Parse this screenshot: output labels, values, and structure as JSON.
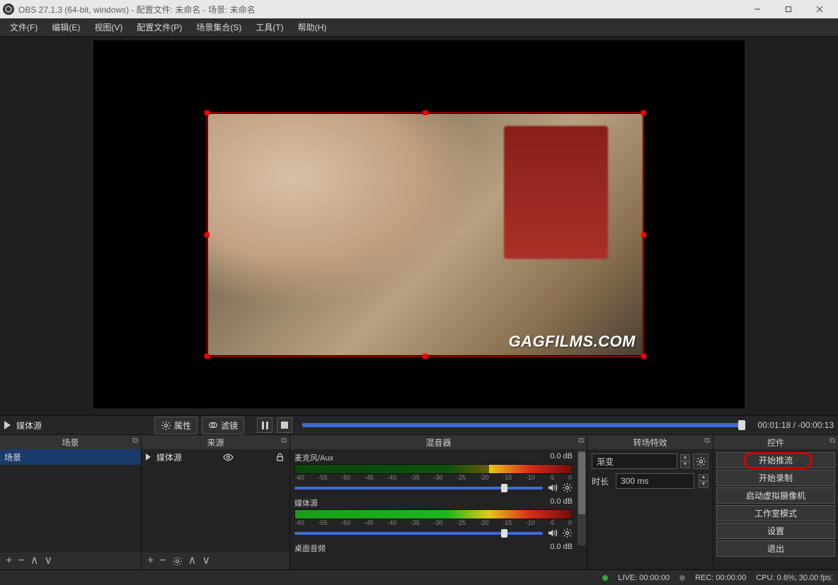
{
  "window": {
    "title": "OBS 27.1.3 (64-bit, windows) - 配置文件: 未命名 - 场景: 未命名"
  },
  "menu": {
    "items": [
      "文件(F)",
      "编辑(E)",
      "视图(V)",
      "配置文件(P)",
      "场景集合(S)",
      "工具(T)",
      "帮助(H)"
    ]
  },
  "preview": {
    "watermark": "GAGFILMS.COM"
  },
  "transport": {
    "source_label": "媒体源",
    "properties": "属性",
    "filters": "滤镜",
    "time_current": "00:01:18",
    "time_remaining": "-00:00:13"
  },
  "panels": {
    "scenes": {
      "title": "场景",
      "items": [
        "场景"
      ]
    },
    "sources": {
      "title": "来源",
      "items": [
        "媒体源"
      ]
    },
    "mixer": {
      "title": "混音器",
      "ticks": [
        "-60",
        "-55",
        "-50",
        "-45",
        "-40",
        "-35",
        "-30",
        "-25",
        "-20",
        "-15",
        "-10",
        "-5",
        "0"
      ],
      "channels": [
        {
          "name": "麦克风/Aux",
          "db": "0.0 dB"
        },
        {
          "name": "媒体源",
          "db": "0.0 dB"
        },
        {
          "name": "桌面音频",
          "db": "0.0 dB"
        }
      ]
    },
    "transitions": {
      "title": "转场特效",
      "selected": "渐变",
      "duration_label": "时长",
      "duration_value": "300 ms"
    },
    "controls": {
      "title": "控件",
      "buttons": [
        "开始推流",
        "开始录制",
        "启动虚拟摄像机",
        "工作室模式",
        "设置",
        "退出"
      ]
    }
  },
  "status": {
    "live": "LIVE: 00:00:00",
    "rec": "REC: 00:00:00",
    "cpu": "CPU: 0.6%, 30.00 fps",
    "stamp": "@51CTO博客"
  }
}
